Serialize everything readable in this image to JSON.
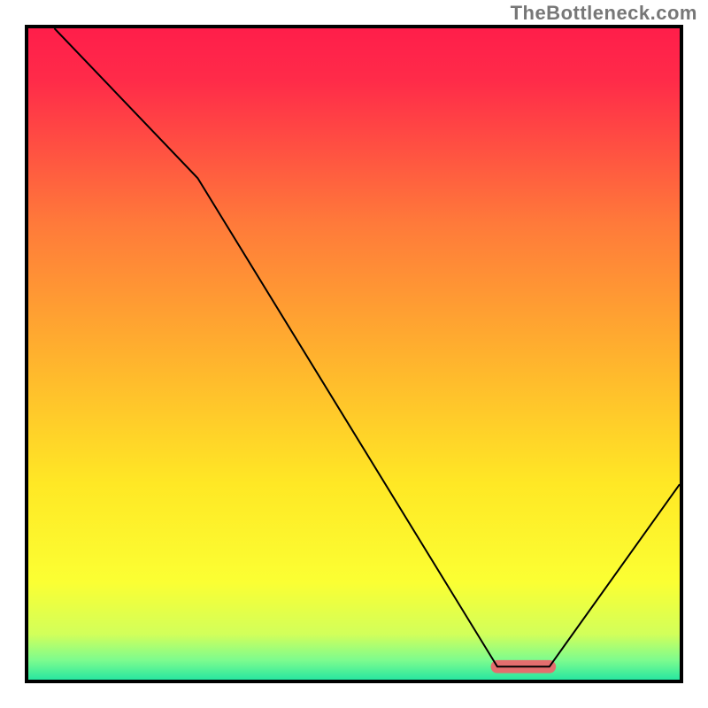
{
  "watermark": "TheBottleneck.com",
  "chart_data": {
    "type": "line",
    "title": "",
    "xlabel": "",
    "ylabel": "",
    "xlim": [
      0,
      100
    ],
    "ylim": [
      0,
      100
    ],
    "background_gradient": {
      "stops": [
        {
          "offset": 0.0,
          "color": "#ff1e4a"
        },
        {
          "offset": 0.08,
          "color": "#ff2b49"
        },
        {
          "offset": 0.3,
          "color": "#ff7a3a"
        },
        {
          "offset": 0.5,
          "color": "#ffb12e"
        },
        {
          "offset": 0.7,
          "color": "#ffe825"
        },
        {
          "offset": 0.85,
          "color": "#fbff33"
        },
        {
          "offset": 0.93,
          "color": "#d2ff5a"
        },
        {
          "offset": 0.97,
          "color": "#7dfc8e"
        },
        {
          "offset": 1.0,
          "color": "#28e7a0"
        }
      ]
    },
    "series": [
      {
        "name": "bottleneck-curve",
        "x": [
          4,
          26,
          72,
          80,
          100
        ],
        "y": [
          100,
          77,
          2,
          2,
          30
        ],
        "stroke": "#000000",
        "stroke_width": 2
      }
    ],
    "annotations": [
      {
        "name": "optimal-marker",
        "shape": "rounded-bar",
        "x_range": [
          71,
          81
        ],
        "y": 2,
        "fill": "#e46e6e"
      }
    ]
  }
}
